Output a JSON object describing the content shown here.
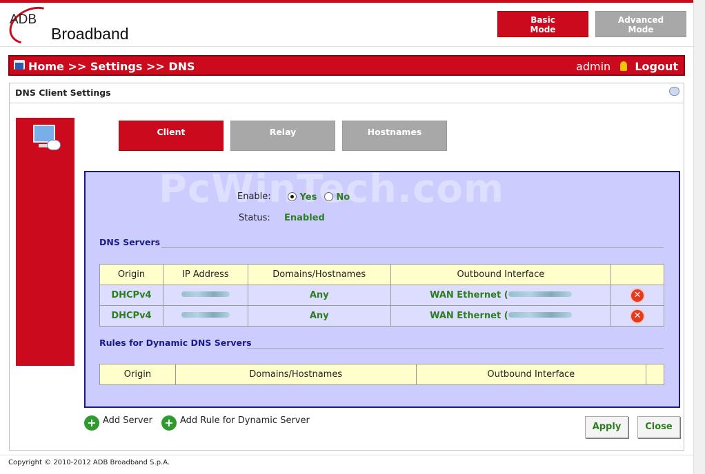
{
  "header": {
    "logo_adb": "ADB",
    "logo_text": "Broadband",
    "basic_mode": [
      "Basic",
      "Mode"
    ],
    "advanced_mode": [
      "Advanced",
      "Mode"
    ]
  },
  "navbar": {
    "breadcrumb": "Home >> Settings >> DNS",
    "user": "admin",
    "logout": "Logout"
  },
  "panel": {
    "title": "DNS Client Settings",
    "tabs": [
      "Client",
      "Relay",
      "Hostnames"
    ],
    "watermark": "PcWinTech.com",
    "enable_label": "Enable:",
    "enable_yes": "Yes",
    "enable_no": "No",
    "status_label": "Status:",
    "status_value": "Enabled",
    "dns_servers_title": "DNS Servers",
    "dns_columns": [
      "Origin",
      "IP Address",
      "Domains/Hostnames",
      "Outbound Interface"
    ],
    "dns_rows": [
      {
        "origin": "DHCPv4",
        "domains": "Any",
        "interface": "WAN Ethernet ("
      },
      {
        "origin": "DHCPv4",
        "domains": "Any",
        "interface": "WAN Ethernet ("
      }
    ],
    "rules_title": "Rules for Dynamic DNS Servers",
    "rules_columns": [
      "Origin",
      "Domains/Hostnames",
      "Outbound Interface"
    ],
    "add_server": "Add Server",
    "add_rule": "Add Rule for Dynamic Server",
    "apply": "Apply",
    "close": "Close"
  },
  "footer": {
    "copyright": "Copyright © 2010-2012 ADB Broadband S.p.A."
  },
  "colors": {
    "brand_red": "#cc0a1e",
    "inactive_gray": "#a8a8a8",
    "content_bg": "#ccccff",
    "status_green": "#2e7d1f"
  }
}
